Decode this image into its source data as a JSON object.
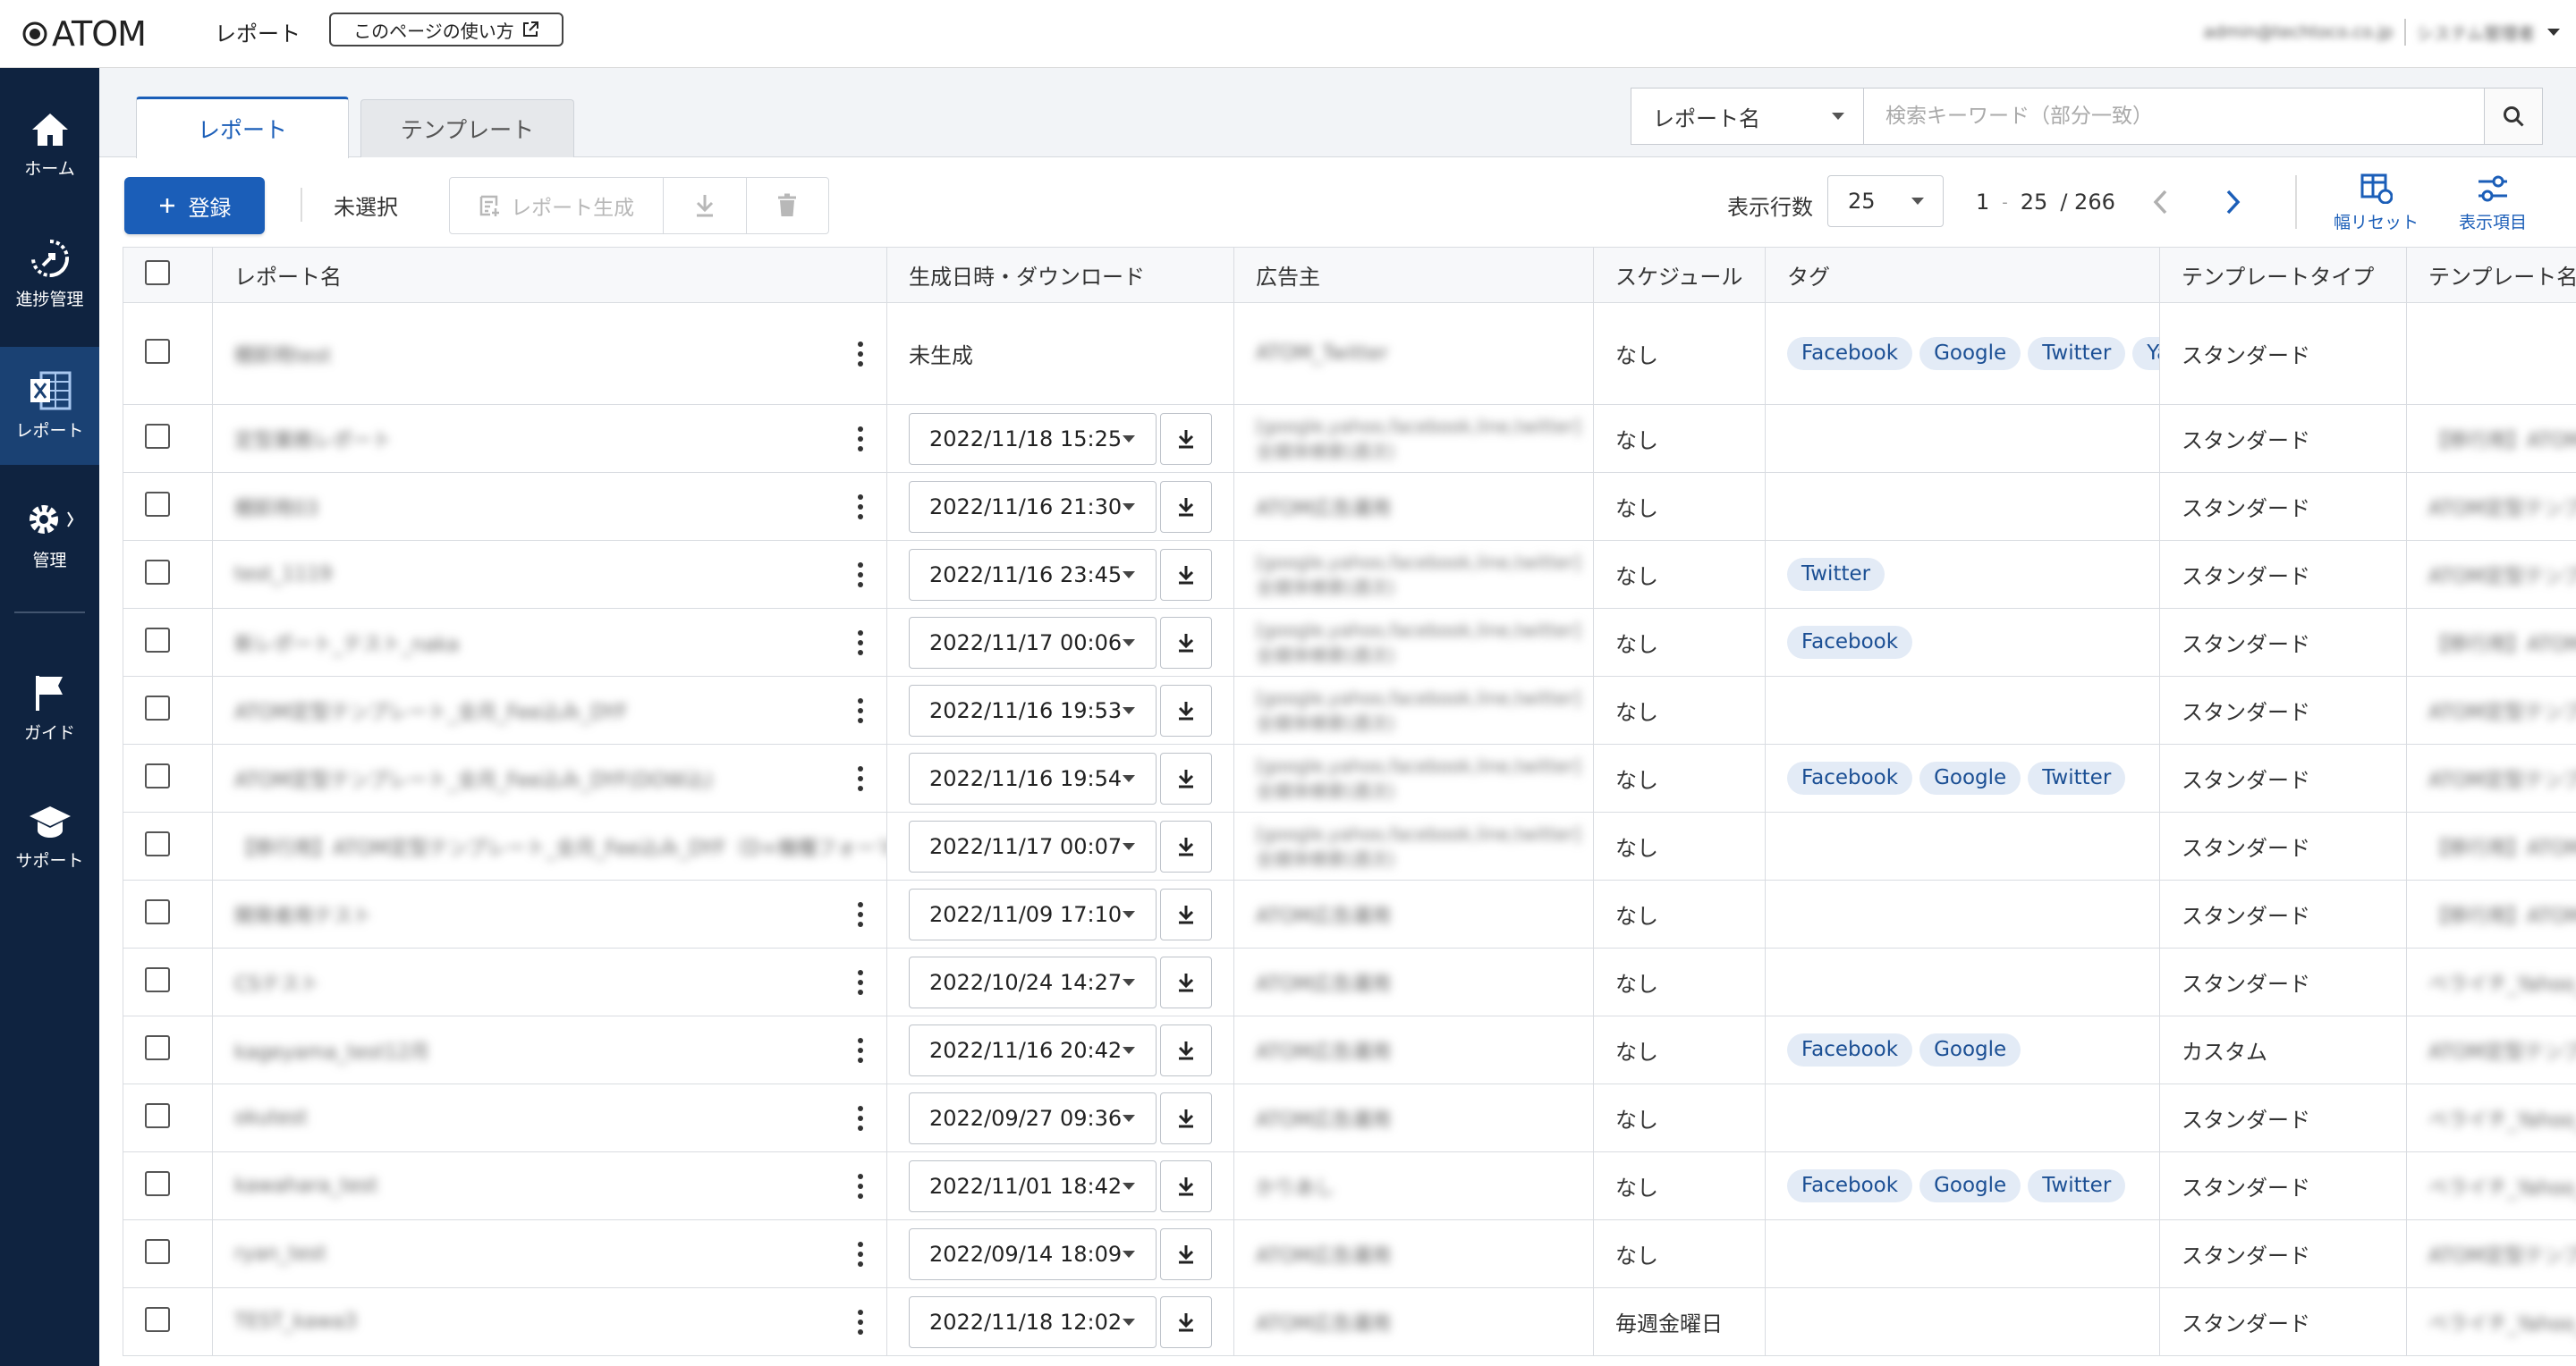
{
  "header": {
    "logo_text": "ATOM",
    "page_title": "レポート",
    "help_label": "このページの使い方",
    "user_email": "admin@techtoco.co.jp",
    "user_role": "システム管理者"
  },
  "sidebar": {
    "items": [
      {
        "label": "ホーム",
        "icon": "home-icon"
      },
      {
        "label": "進捗管理",
        "icon": "progress-icon"
      },
      {
        "label": "レポート",
        "icon": "excel-icon",
        "active": true
      },
      {
        "label": "管理",
        "icon": "gear-icon"
      },
      {
        "label": "ガイド",
        "icon": "flag-icon"
      },
      {
        "label": "サポート",
        "icon": "graduation-cap-icon"
      }
    ]
  },
  "tabs": [
    {
      "label": "レポート",
      "active": true
    },
    {
      "label": "テンプレート",
      "active": false
    }
  ],
  "search": {
    "field_label": "レポート名",
    "placeholder": "検索キーワード（部分一致）"
  },
  "toolbar": {
    "register_label": "登録",
    "selection_status": "未選択",
    "generate_label": "レポート生成",
    "rows_label": "表示行数",
    "rows_value": "25",
    "range_start": "1",
    "range_sep": "-",
    "range_end": "25",
    "total": "/ 266",
    "reset_label": "幅リセット",
    "columns_label": "表示項目"
  },
  "table": {
    "columns": [
      "レポート名",
      "生成日時・ダウンロード",
      "広告主",
      "スケジュール",
      "タグ",
      "テンプレートタイプ",
      "テンプレート名"
    ],
    "rows": [
      {
        "name": "棚卸用test",
        "date": "未生成",
        "advertiser": "ATOM_Twitter",
        "schedule": "なし",
        "tags": [
          "Facebook",
          "Google",
          "Twitter",
          "Yahoo!"
        ],
        "template_type": "スタンダード",
        "template_name": ""
      },
      {
        "name": "定型業務レポート",
        "date": "2022/11/18 15:25",
        "advertiser": "[google,yahoo,facebook,line,twitter]全媒体検索(週次)",
        "schedule": "なし",
        "tags": [],
        "template_type": "スタンダード",
        "template_name": "【移行用】ATOM定型テン"
      },
      {
        "name": "棚卸用03",
        "date": "2022/11/16 21:30",
        "advertiser": "ATOM広告運用",
        "schedule": "なし",
        "tags": [],
        "template_type": "スタンダード",
        "template_name": "ATOM定型テンプレート_全"
      },
      {
        "name": "test_1119",
        "date": "2022/11/16 23:45",
        "advertiser": "[google,yahoo,facebook,line,twitter]全媒体検索(週次)",
        "schedule": "なし",
        "tags": [
          "Twitter"
        ],
        "template_type": "スタンダード",
        "template_name": "ATOM定型テンプレート_全"
      },
      {
        "name": "新レポート_テスト_naka",
        "date": "2022/11/17 00:06",
        "advertiser": "[google,yahoo,facebook,line,twitter]全媒体検索(週次)",
        "schedule": "なし",
        "tags": [
          "Facebook"
        ],
        "template_type": "スタンダード",
        "template_name": "【移行用】ATOM定型テン"
      },
      {
        "name": "ATOM定型テンプレート_全月_Fee込み_DYF",
        "date": "2022/11/16 19:53",
        "advertiser": "[google,yahoo,facebook,line,twitter]全媒体検索(週次)",
        "schedule": "なし",
        "tags": [],
        "template_type": "スタンダード",
        "template_name": "ATOM定型テンプレート_全"
      },
      {
        "name": "ATOM定型テンプレート_全月_Fee込み_DYF(DOW込)",
        "date": "2022/11/16 19:54",
        "advertiser": "[google,yahoo,facebook,line,twitter]全媒体検索(週次)",
        "schedule": "なし",
        "tags": [
          "Facebook",
          "Google",
          "Twitter"
        ],
        "template_type": "スタンダード",
        "template_name": "ATOM定型テンプレート_全"
      },
      {
        "name": "【移行用】ATOM定型テンプレート_全月_Fee込み_DYF（D+機種フォーマット仕分）",
        "date": "2022/11/17 00:07",
        "advertiser": "[google,yahoo,facebook,line,twitter]全媒体検索(週次)",
        "schedule": "なし",
        "tags": [],
        "template_type": "スタンダード",
        "template_name": "【移行用】ATOM定型テン"
      },
      {
        "name": "開発者用テスト",
        "date": "2022/11/09 17:10",
        "advertiser": "ATOM広告運用",
        "schedule": "なし",
        "tags": [],
        "template_type": "スタンダード",
        "template_name": "【移行用】ATOM定型テン"
      },
      {
        "name": "CSテスト",
        "date": "2022/10/24 14:27",
        "advertiser": "ATOM広告運用",
        "schedule": "なし",
        "tags": [],
        "template_type": "スタンダード",
        "template_name": "ベライチ_Yahoo_Google_F"
      },
      {
        "name": "kageyama_test12月",
        "date": "2022/11/16 20:42",
        "advertiser": "ATOM広告運用",
        "schedule": "なし",
        "tags": [
          "Facebook",
          "Google"
        ],
        "template_type": "カスタム",
        "template_name": "ATOM定型テンプレート_全"
      },
      {
        "name": "okutest",
        "date": "2022/09/27 09:36",
        "advertiser": "ATOM広告運用",
        "schedule": "なし",
        "tags": [],
        "template_type": "スタンダード",
        "template_name": "ベライチ_Yahoo_Google_F"
      },
      {
        "name": "kawahara_test",
        "date": "2022/11/01 18:42",
        "advertiser": "かりあし",
        "schedule": "なし",
        "tags": [
          "Facebook",
          "Google",
          "Twitter"
        ],
        "template_type": "スタンダード",
        "template_name": "ベライチ_Yahoo_Google_F"
      },
      {
        "name": "ryan_test",
        "date": "2022/09/14 18:09",
        "advertiser": "ATOM広告運用",
        "schedule": "なし",
        "tags": [],
        "template_type": "スタンダード",
        "template_name": "ATOM定型テンプレート_全"
      },
      {
        "name": "TEST_kawa3",
        "date": "2022/11/18 12:02",
        "advertiser": "ATOM広告運用",
        "schedule": "毎週金曜日",
        "tags": [],
        "template_type": "スタンダード",
        "template_name": "ベライチ_Yahoo_Google_F"
      }
    ]
  }
}
